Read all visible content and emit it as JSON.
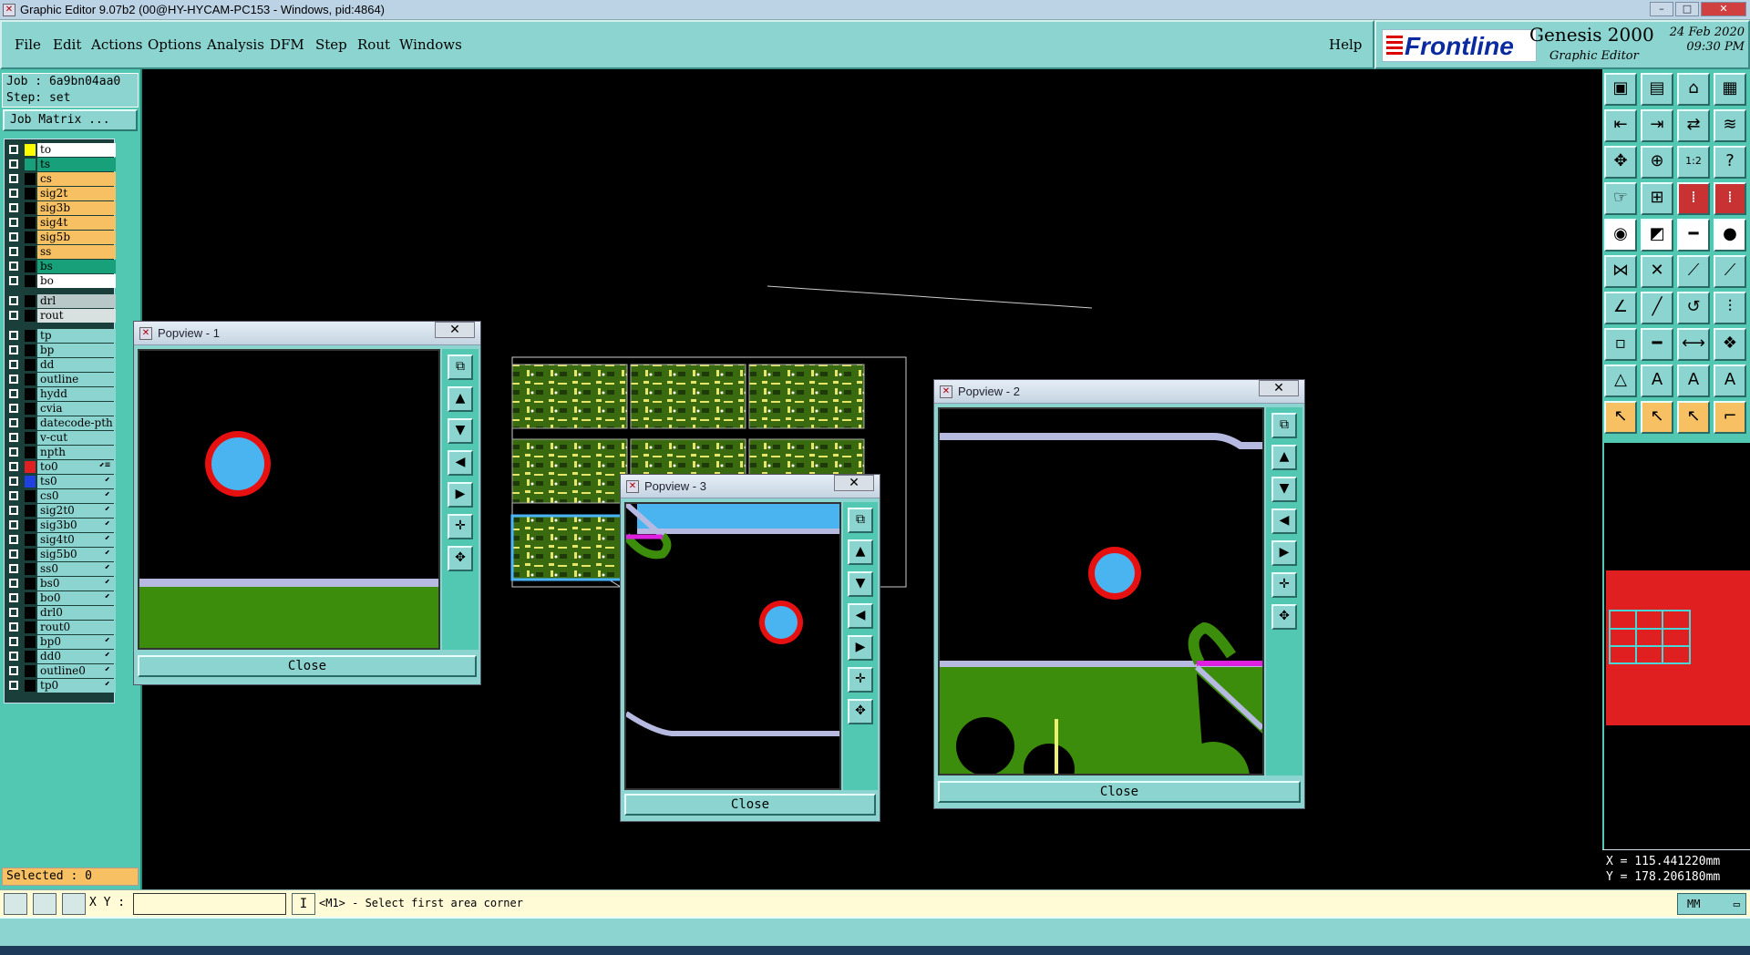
{
  "window": {
    "title": "Graphic Editor 9.07b2 (00@HY-HYCAM-PC153 - Windows, pid:4864)",
    "app_icon": "x-window-icon"
  },
  "menu": {
    "items": [
      "File",
      "Edit",
      "Actions",
      "Options",
      "Analysis",
      "DFM",
      "Step",
      "Rout",
      "Windows"
    ],
    "help": "Help"
  },
  "brand": {
    "logo": "Frontline",
    "product": "Genesis 2000",
    "subtitle": "Graphic Editor",
    "date": "24 Feb 2020",
    "time": "09:30 PM"
  },
  "job": {
    "job_line": "Job : 6a9bn04aa0",
    "step_line": "Step: set",
    "matrix_button": "Job Matrix ..."
  },
  "layers": [
    {
      "name": "to",
      "color": "#ffffff",
      "swatch": "#ffff00"
    },
    {
      "name": "ts",
      "color": "#18a07a",
      "swatch": "#18a07a"
    },
    {
      "name": "cs",
      "color": "#f6c063",
      "swatch": "#000000"
    },
    {
      "name": "sig2t",
      "color": "#f6c063",
      "swatch": "#000000"
    },
    {
      "name": "sig3b",
      "color": "#f6c063",
      "swatch": "#000000"
    },
    {
      "name": "sig4t",
      "color": "#f6c063",
      "swatch": "#000000"
    },
    {
      "name": "sig5b",
      "color": "#f6c063",
      "swatch": "#000000"
    },
    {
      "name": "ss",
      "color": "#f6c063",
      "swatch": "#000000"
    },
    {
      "name": "bs",
      "color": "#18a07a",
      "swatch": "#000000"
    },
    {
      "name": "bo",
      "color": "#ffffff",
      "swatch": "#000000"
    },
    {
      "name": "drl",
      "color": "#b8c8c8",
      "swatch": "#000000"
    },
    {
      "name": "rout",
      "color": "#d8e0e0",
      "swatch": "#000000"
    },
    {
      "name": "tp",
      "color": "#8cd4d0",
      "swatch": "#000000"
    },
    {
      "name": "bp",
      "color": "#8cd4d0",
      "swatch": "#000000"
    },
    {
      "name": "dd",
      "color": "#8cd4d0",
      "swatch": "#000000"
    },
    {
      "name": "outline",
      "color": "#8cd4d0",
      "swatch": "#000000"
    },
    {
      "name": "hydd",
      "color": "#8cd4d0",
      "swatch": "#000000"
    },
    {
      "name": "cvia",
      "color": "#8cd4d0",
      "swatch": "#000000"
    },
    {
      "name": "datecode-pth",
      "color": "#8cd4d0",
      "swatch": "#000000"
    },
    {
      "name": "v-cut",
      "color": "#8cd4d0",
      "swatch": "#000000"
    },
    {
      "name": "npth",
      "color": "#8cd4d0",
      "swatch": "#000000"
    },
    {
      "name": "to0",
      "color": "#8cd4d0",
      "swatch": "#e02020",
      "mark": "⬋≡"
    },
    {
      "name": "ts0",
      "color": "#8cd4d0",
      "swatch": "#2040e0",
      "mark": "⬋"
    },
    {
      "name": "cs0",
      "color": "#8cd4d0",
      "swatch": "#000000",
      "mark": "⬋"
    },
    {
      "name": "sig2t0",
      "color": "#8cd4d0",
      "swatch": "#000000",
      "mark": "⬋"
    },
    {
      "name": "sig3b0",
      "color": "#8cd4d0",
      "swatch": "#000000",
      "mark": "⬋"
    },
    {
      "name": "sig4t0",
      "color": "#8cd4d0",
      "swatch": "#000000",
      "mark": "⬋"
    },
    {
      "name": "sig5b0",
      "color": "#8cd4d0",
      "swatch": "#000000",
      "mark": "⬋"
    },
    {
      "name": "ss0",
      "color": "#8cd4d0",
      "swatch": "#000000",
      "mark": "⬋"
    },
    {
      "name": "bs0",
      "color": "#8cd4d0",
      "swatch": "#000000",
      "mark": "⬋"
    },
    {
      "name": "bo0",
      "color": "#8cd4d0",
      "swatch": "#000000",
      "mark": "⬋"
    },
    {
      "name": "drl0",
      "color": "#8cd4d0",
      "swatch": "#000000"
    },
    {
      "name": "rout0",
      "color": "#8cd4d0",
      "swatch": "#000000"
    },
    {
      "name": "bp0",
      "color": "#8cd4d0",
      "swatch": "#000000",
      "mark": "⬋"
    },
    {
      "name": "dd0",
      "color": "#8cd4d0",
      "swatch": "#000000",
      "mark": "⬋"
    },
    {
      "name": "outline0",
      "color": "#8cd4d0",
      "swatch": "#000000",
      "mark": "⬋"
    },
    {
      "name": "tp0",
      "color": "#8cd4d0",
      "swatch": "#000000",
      "mark": "⬋"
    }
  ],
  "selected": "Selected : 0",
  "popviews": [
    {
      "title": "Popview - 1",
      "close": "Close"
    },
    {
      "title": "Popview - 2",
      "close": "Close"
    },
    {
      "title": "Popview - 3",
      "close": "Close"
    }
  ],
  "coords": {
    "x": "X = 115.441220mm",
    "y": "Y = 178.206180mm"
  },
  "status": {
    "xy_label": "X Y :",
    "xy_value": "",
    "prompt": "<M1> - Select first area corner",
    "units": "MM"
  }
}
